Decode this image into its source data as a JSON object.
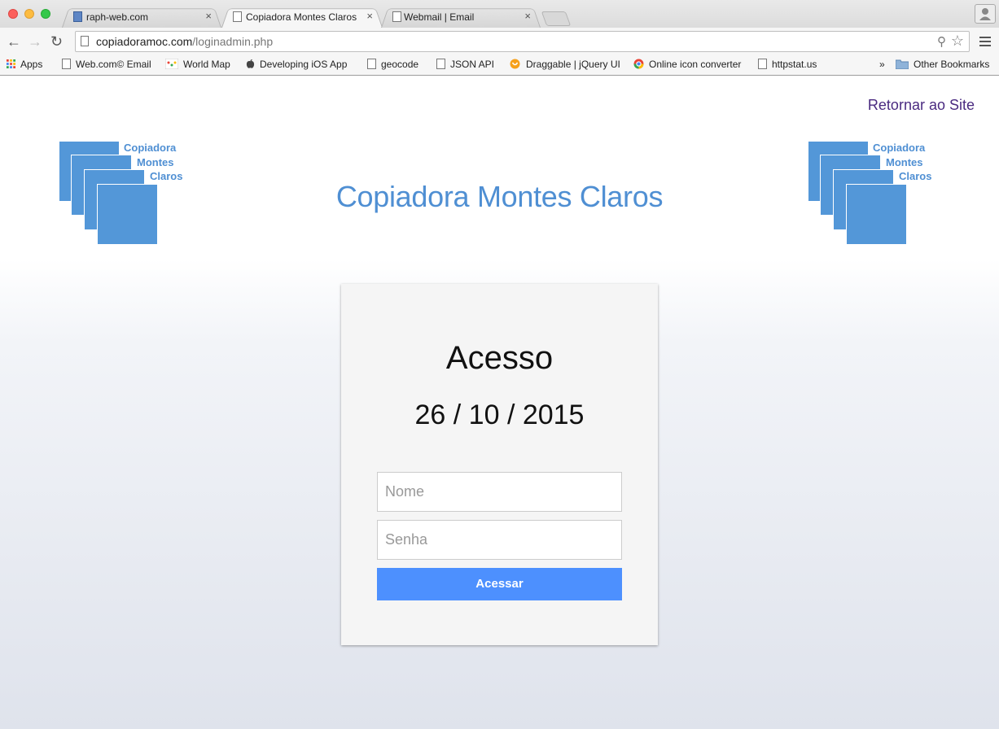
{
  "browser": {
    "tabs": [
      {
        "title": "raph-web.com",
        "active": false
      },
      {
        "title": "Copiadora Montes Claros",
        "active": true
      },
      {
        "title": "Webmail | Email",
        "active": false
      }
    ],
    "close_glyph": "×",
    "url_host": "copiadoramoc.com",
    "url_path": "/loginadmin.php",
    "bookmarks": [
      {
        "label": "Apps",
        "icon": "apps-grid-icon"
      },
      {
        "label": "Web.com© Email",
        "icon": "page-icon"
      },
      {
        "label": "World Map",
        "icon": "world-map-icon"
      },
      {
        "label": "Developing iOS App",
        "icon": "apple-icon"
      },
      {
        "label": "geocode",
        "icon": "page-icon"
      },
      {
        "label": "JSON API",
        "icon": "page-icon"
      },
      {
        "label": "Draggable | jQuery UI",
        "icon": "jquery-icon"
      },
      {
        "label": "Online icon converter",
        "icon": "chrome-icon"
      },
      {
        "label": "httpstat.us",
        "icon": "page-icon"
      }
    ],
    "overflow_glyph": "»",
    "other_bookmarks": "Other Bookmarks"
  },
  "page": {
    "return_link": "Retornar ao Site",
    "logo_text": [
      "Copiadora",
      "Montes",
      "Claros"
    ],
    "site_title": "Copiadora Montes Claros"
  },
  "login": {
    "heading": "Acesso",
    "date": "26 / 10 / 2015",
    "name_placeholder": "Nome",
    "password_placeholder": "Senha",
    "submit_label": "Acessar"
  },
  "colors": {
    "brand_blue": "#4f8fd3",
    "logo_square": "#5397d8",
    "button_blue": "#4d90fe",
    "link_purple": "#4a2a80"
  }
}
